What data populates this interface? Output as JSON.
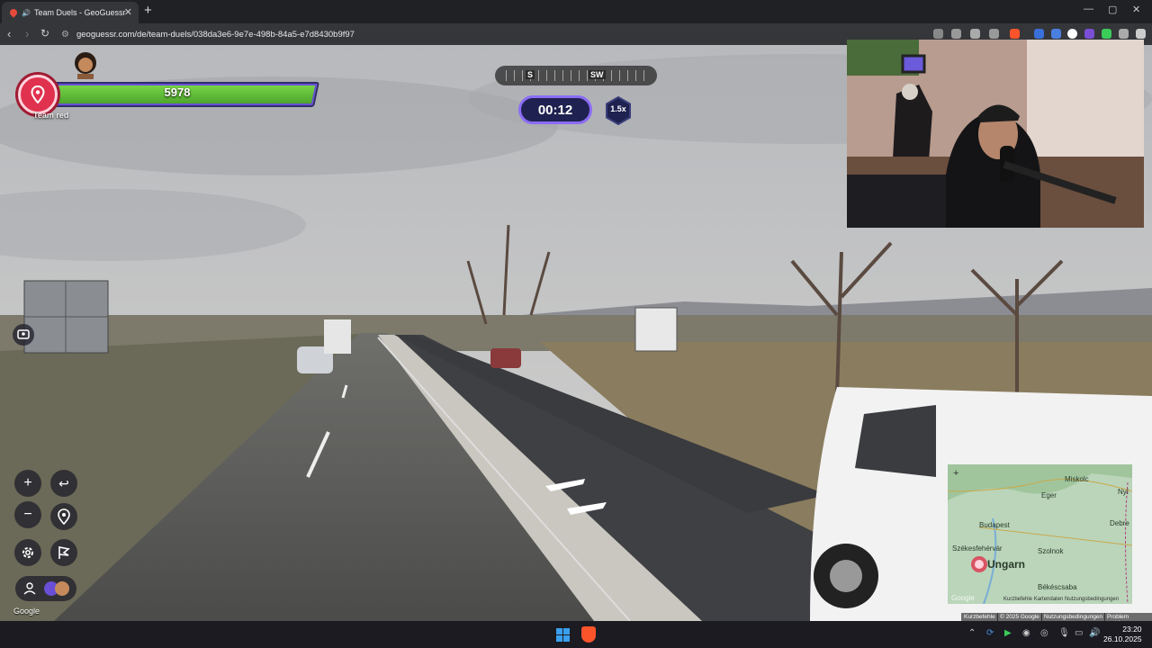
{
  "browser": {
    "tab_title": "Team Duels - GeoGuessr",
    "close_label": "✕",
    "newtab_label": "+",
    "url": "geoguessr.com/de/team-duels/038da3e6-9e7e-498b-84a5-e7d8430b9f97",
    "window_controls": [
      "—",
      "▢",
      "✕"
    ]
  },
  "hud": {
    "health": "5978",
    "team_name": "Team red",
    "compass_left": "S",
    "compass_right": "SW",
    "timer": "00:12",
    "multiplier": "1.5x",
    "google_label": "Google",
    "controls": {
      "zoom_in": "+",
      "zoom_out": "−",
      "undo": "↩"
    }
  },
  "minimap": {
    "places": [
      "Miskolc",
      "Eger",
      "Budapest",
      "Székesfehérvár",
      "Szolnok",
      "Ungarn",
      "Nyí",
      "Debre",
      "Békéscsaba"
    ],
    "plus": "+",
    "watermark": "Google",
    "footer": "Kurzbefehle   Kartendaten   Nutzungsbedingungen"
  },
  "attribution": {
    "shortcuts": "Kurzbefehle",
    "copyright": "© 2025 Google",
    "terms": "Nutzungsbedingungen",
    "report": "Problem melden"
  },
  "taskbar": {
    "time": "23:20",
    "date": "26.10.2025"
  },
  "colors": {
    "health_bar": "#5ec235",
    "team_red": "#e0324e",
    "timer_border": "#8b6cf5"
  }
}
